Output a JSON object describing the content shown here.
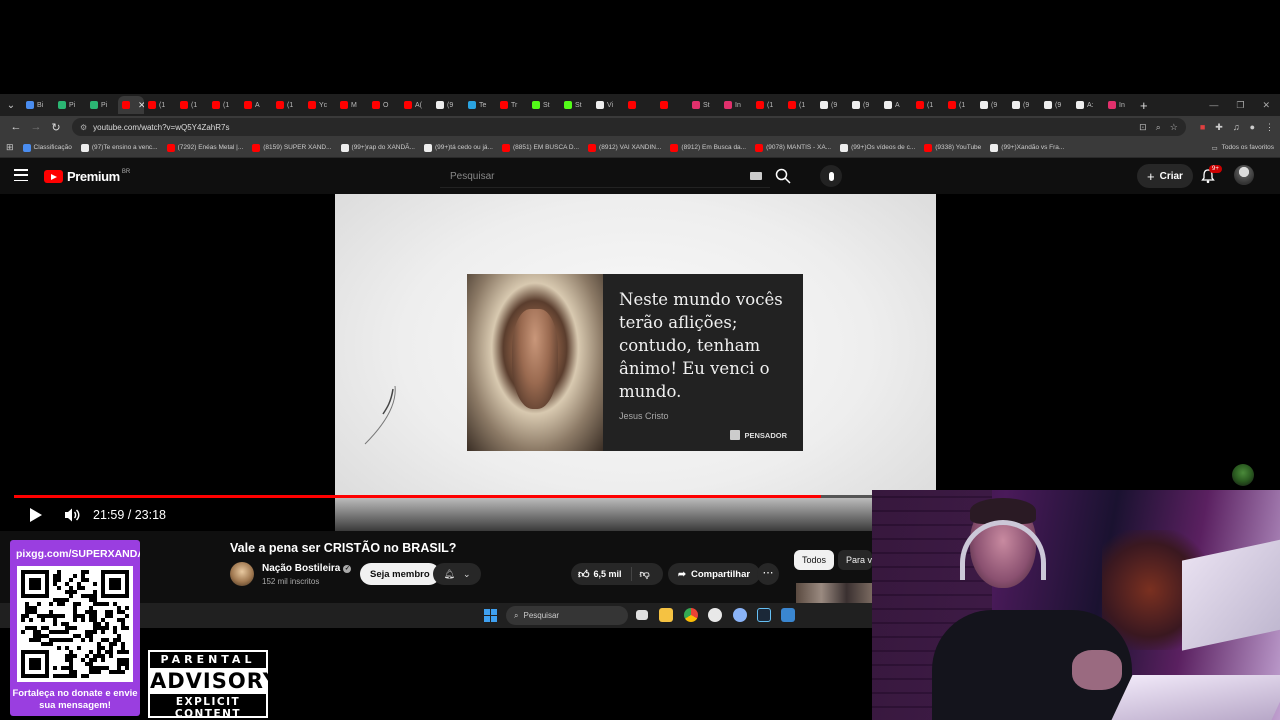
{
  "browser": {
    "tabs": [
      {
        "label": "Bi",
        "color": "#4a8df0"
      },
      {
        "label": "Pi",
        "color": "#2bb673"
      },
      {
        "label": "Pi",
        "color": "#2bb673"
      },
      {
        "label": "",
        "color": "#ff0000",
        "active": true
      },
      {
        "label": "(1",
        "color": "#ff0000"
      },
      {
        "label": "(1",
        "color": "#ff0000"
      },
      {
        "label": "(1",
        "color": "#ff0000"
      },
      {
        "label": "A",
        "color": "#ff0000"
      },
      {
        "label": "(1",
        "color": "#ff0000"
      },
      {
        "label": "Yc",
        "color": "#ff0000"
      },
      {
        "label": "M",
        "color": "#ff0000"
      },
      {
        "label": "O",
        "color": "#ff0000"
      },
      {
        "label": "A(",
        "color": "#ff0000"
      },
      {
        "label": "(9",
        "color": "#eeeeee"
      },
      {
        "label": "Te",
        "color": "#2aa3e0"
      },
      {
        "label": "Tr",
        "color": "#ff0000"
      },
      {
        "label": "St",
        "color": "#53fc18"
      },
      {
        "label": "St",
        "color": "#53fc18"
      },
      {
        "label": "Vi",
        "color": "#eeeeee"
      },
      {
        "label": "",
        "color": "#ff0000"
      },
      {
        "label": "",
        "color": "#ff0000"
      },
      {
        "label": "St",
        "color": "#e1306c"
      },
      {
        "label": "In",
        "color": "#e1306c"
      },
      {
        "label": "(1",
        "color": "#ff0000"
      },
      {
        "label": "(1",
        "color": "#ff0000"
      },
      {
        "label": "(9",
        "color": "#eeeeee"
      },
      {
        "label": "(9",
        "color": "#eeeeee"
      },
      {
        "label": "A",
        "color": "#eeeeee"
      },
      {
        "label": "(1",
        "color": "#ff0000"
      },
      {
        "label": "(1",
        "color": "#ff0000"
      },
      {
        "label": "(9",
        "color": "#eeeeee"
      },
      {
        "label": "(9",
        "color": "#eeeeee"
      },
      {
        "label": "(9",
        "color": "#eeeeee"
      },
      {
        "label": "A:",
        "color": "#eeeeee"
      },
      {
        "label": "In",
        "color": "#e1306c"
      }
    ],
    "url": "youtube.com/watch?v=wQ5Y4ZahR7s",
    "bookmarks": [
      {
        "label": "Classificação",
        "color": "#4a8df0"
      },
      {
        "label": "(97)Te ensino a venc...",
        "color": "#eeeeee"
      },
      {
        "label": "(7292) Enéas Metal |...",
        "color": "#ff0000"
      },
      {
        "label": "(8159) SUPER XAND...",
        "color": "#ff0000"
      },
      {
        "label": "(99+)rap do XANDÃ...",
        "color": "#eeeeee"
      },
      {
        "label": "(99+)tá cedo ou já...",
        "color": "#eeeeee"
      },
      {
        "label": "(8851) EM BUSCA D...",
        "color": "#ff0000"
      },
      {
        "label": "(8912) VAI XANDIN...",
        "color": "#ff0000"
      },
      {
        "label": "(8912) Em Busca da...",
        "color": "#ff0000"
      },
      {
        "label": "(9078) MANTIS - XA...",
        "color": "#ff0000"
      },
      {
        "label": "(99+)Os vídeos de c...",
        "color": "#eeeeee"
      },
      {
        "label": "(9338) YouTube",
        "color": "#ff0000"
      },
      {
        "label": "(99+)Xandão vs Fra...",
        "color": "#eeeeee"
      }
    ],
    "all_bookmarks": "Todos os favoritos"
  },
  "youtube": {
    "logo_word": "Premium",
    "logo_region": "BR",
    "search_placeholder": "Pesquisar",
    "create_label": "Criar",
    "notif_badge": "9+",
    "video": {
      "quote": "Neste mundo vocês terão aflições; contudo, tenham ânimo! Eu venci o mundo.",
      "quote_author": "Jesus Cristo",
      "quote_brand": "PENSADOR",
      "time": "21:59 / 23:18",
      "progress": 0.94
    },
    "title": "Vale a pena ser CRISTÃO no BRASIL?",
    "channel": "Nação Bostileira",
    "subscribers": "152 mil inscritos",
    "join_label": "Seja membro",
    "likes": "6,5 mil",
    "share_label": "Compartilhar",
    "chips": [
      "Todos",
      "Para vo"
    ]
  },
  "taskbar": {
    "search_placeholder": "Pesquisar"
  },
  "overlay": {
    "pix_url": "pixgg.com/SUPERXANDA",
    "pix_caption": "Fortaleça no donate e envie sua mensagem!",
    "advisory_top": "PARENTAL",
    "advisory_mid": "ADVISORY",
    "advisory_bot": "EXPLICIT CONTENT"
  }
}
